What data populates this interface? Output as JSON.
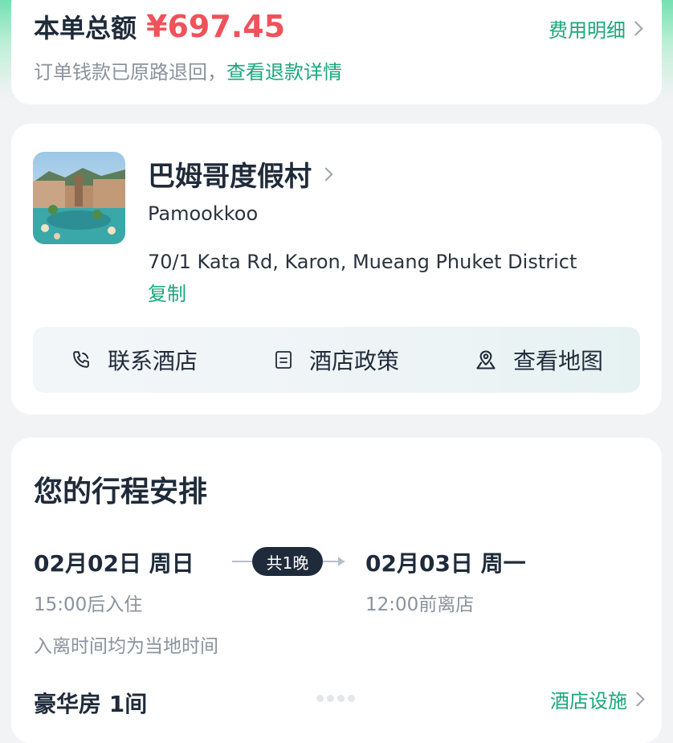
{
  "summary": {
    "total_label": "本单总额",
    "total_amount": "¥697.45",
    "fee_detail_label": "费用明细",
    "refund_text": "订单钱款已原路退回，",
    "refund_link": "查看退款详情"
  },
  "hotel": {
    "name": "巴姆哥度假村",
    "name_en": "Pamookkoo",
    "address": "70/1 Kata Rd, Karon, Mueang Phuket District",
    "copy_label": "复制",
    "actions": [
      {
        "label": "联系酒店",
        "icon": "phone-icon"
      },
      {
        "label": "酒店政策",
        "icon": "document-icon"
      },
      {
        "label": "查看地图",
        "icon": "map-pin-icon"
      }
    ]
  },
  "trip": {
    "title": "您的行程安排",
    "checkin_date": "02月02日 周日",
    "checkout_date": "02月03日 周一",
    "nights": "共1晚",
    "checkin_time": "15:00后入住",
    "checkout_time": "12:00前离店",
    "local_time_note": "入离时间均为当地时间",
    "room": "豪华房 1间",
    "facilities_label": "酒店设施"
  },
  "colors": {
    "accent_green": "#1aa87a",
    "price_red": "#f0525a",
    "dark_text": "#1f2b3a",
    "muted_text": "#8a929c"
  }
}
